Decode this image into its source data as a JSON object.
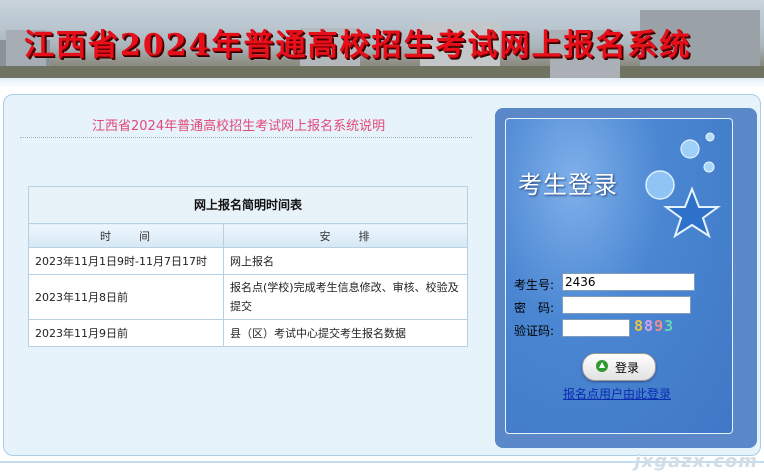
{
  "banner": {
    "title": "江西省2024年普通高校招生考试网上报名系统"
  },
  "intro": {
    "title": "江西省2024年普通高校招生考试网上报名系统说明"
  },
  "schedule": {
    "caption": "网上报名简明时间表",
    "headers": [
      "时　　间",
      "安　　排"
    ],
    "rows": [
      {
        "time": "2023年11月1日9时-11月7日17时",
        "task": "网上报名"
      },
      {
        "time": "2023年11月8日前",
        "task": "报名点(学校)完成考生信息修改、审核、校验及提交"
      },
      {
        "time": "2023年11月9日前",
        "task": "县（区）考试中心提交考生报名数据"
      }
    ]
  },
  "login": {
    "title": "考生登录",
    "exam_no_label": "考生号:",
    "exam_no_value": "2436",
    "password_label": "密　码:",
    "captcha_label": "验证码:",
    "captcha_text": "8893",
    "login_button": "登录",
    "site_link": "报名点用户由此登录"
  },
  "watermark": "jxgazx.com",
  "colors": {
    "accent_pink": "#e4477a",
    "panel_blue": "#5b88c8",
    "banner_red": "#e60f1a"
  },
  "icons": [
    "login-arrow-icon",
    "star-icon",
    "bubble-icon"
  ]
}
